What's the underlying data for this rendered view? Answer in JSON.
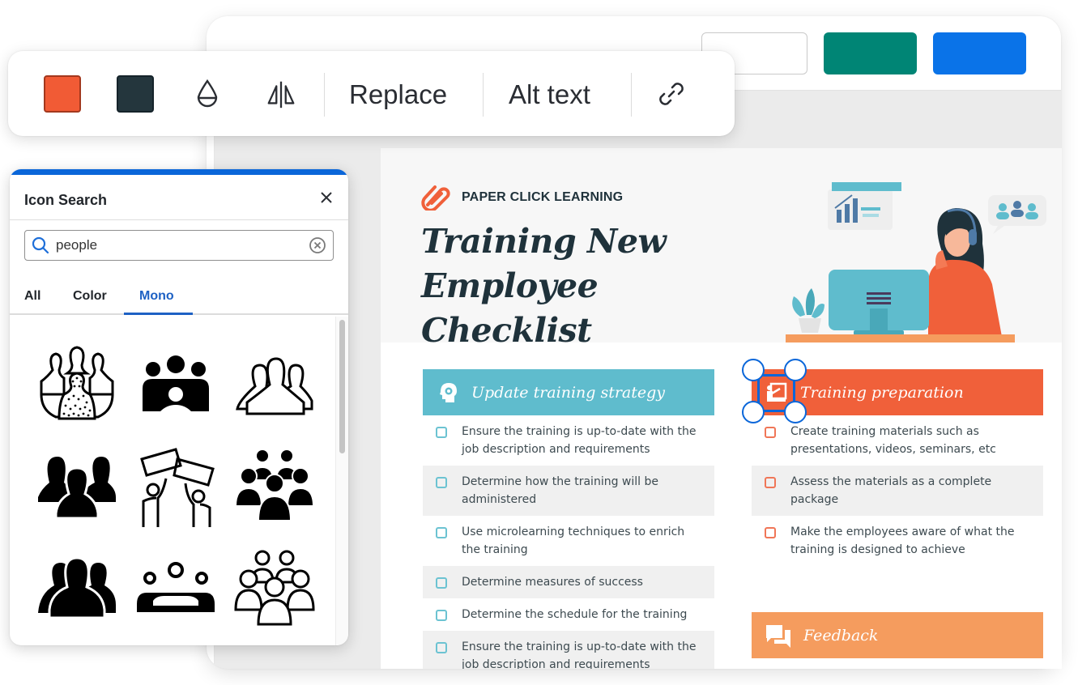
{
  "toolbar": {
    "colors": {
      "primary": "#f15b35",
      "secondary": "#24363d"
    },
    "icons": [
      "opacity-icon",
      "flip-icon",
      "link-icon"
    ],
    "replace_label": "Replace",
    "alt_text_label": "Alt text"
  },
  "app": {
    "topbar_buttons": [
      {
        "style": "outline",
        "color": "#ffffff"
      },
      {
        "style": "filled",
        "color": "#008575"
      },
      {
        "style": "filled",
        "color": "#0a73e8"
      }
    ]
  },
  "icon_search": {
    "title": "Icon Search",
    "close_icon": "close-icon",
    "search_value": "people",
    "search_icon": "search-icon",
    "clear_icon": "clear-circle-icon",
    "tabs": [
      {
        "label": "All",
        "active": false
      },
      {
        "label": "Color",
        "active": false
      },
      {
        "label": "Mono",
        "active": true
      }
    ],
    "results": [
      "people-group-outline-highlight-icon",
      "people-group-solid-circle-icon",
      "people-silhouettes-outline-icon",
      "people-silhouettes-solid-icon",
      "people-protest-signs-icon",
      "people-crowd-solid-icon",
      "people-silhouettes-solid-stacked-icon",
      "people-meeting-table-icon",
      "people-crowd-outline-icon"
    ]
  },
  "document": {
    "brand": "PAPER CLICK LEARNING",
    "title_line1": "Training New",
    "title_line2": "Employee Checklist",
    "accent_colors": {
      "teal": "#5fbccd",
      "orange": "#f0603a",
      "peach": "#f59c5e",
      "text": "#1f323b"
    },
    "sections": [
      {
        "title": "Update training strategy",
        "icon": "head-gear-icon",
        "items": [
          "Ensure the training is up-to-date with the job description and requirements",
          "Determine how the training will be administered",
          "Use microlearning techniques to enrich the training",
          "Determine measures of success",
          "Determine the schedule for the training",
          "Ensure the training is up-to-date with the job description and requirements"
        ]
      },
      {
        "title": "Training preparation",
        "icon": "presentation-teacher-icon",
        "items": [
          "Create training materials such as presentations, videos, seminars, etc",
          "Assess the materials as a complete package",
          "Make the employees aware of what the training is designed to achieve"
        ]
      },
      {
        "title": "Feedback",
        "icon": "chat-bubbles-icon",
        "items": []
      }
    ]
  }
}
